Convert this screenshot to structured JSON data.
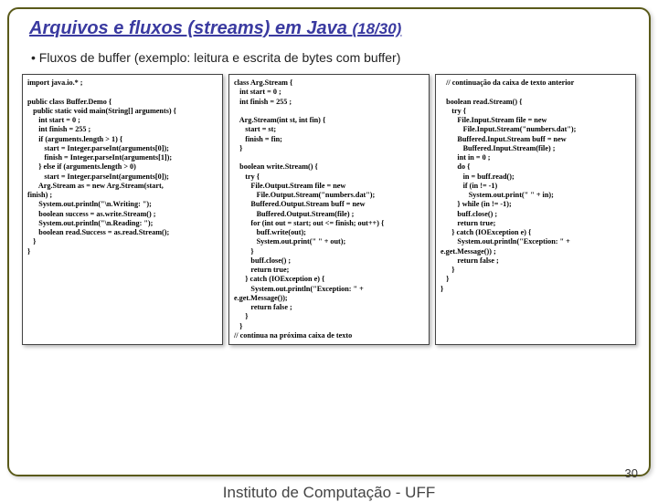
{
  "title_main": "Arquivos e fluxos (streams) em Java ",
  "title_count": "(18/30)",
  "bullet": "•   Fluxos de buffer (exemplo: leitura  e escrita de bytes com buffer)",
  "code": {
    "col1": "import java.io.* ;\n\npublic class Buffer.Demo {\n   public static void main(String[] arguments) {\n      int start = 0 ;\n      int finish = 255 ;\n      if (arguments.length > 1) {\n         start = Integer.parseInt(arguments[0]);\n         finish = Integer.parseInt(arguments[1]);\n      } else if (arguments.length > 0)\n         start = Integer.parseInt(arguments[0]);\n      Arg.Stream as = new Arg.Stream(start,\nfinish) ;\n      System.out.println(\"\\n.Writing: \");\n      boolean success = as.write.Stream() ;\n      System.out.println(\"\\n.Reading: \");\n      boolean read.Success = as.read.Stream();\n   }\n}",
    "col2": "class Arg.Stream {\n   int start = 0 ;\n   int finish = 255 ;\n\n   Arg.Stream(int st, int fin) {\n      start = st;\n      finish = fin;\n   }\n\n   boolean write.Stream() {\n      try {\n         File.Output.Stream file = new\n            File.Output.Stream(\"numbers.dat\");\n         Buffered.Output.Stream buff = new\n            Buffered.Output.Stream(file) ;\n         for (int out = start; out <= finish; out++) {\n            buff.write(out);\n            System.out.print(\" \" + out);\n         }\n         buff.close() ;\n         return true;\n      } catch (IOException e) {\n         System.out.println(\"Exception: \" +\ne.get.Message());\n         return false ;\n      }\n   }\n// continua na próxima caixa de texto",
    "col3": "   // continuação da caixa de texto anterior\n\n   boolean read.Stream() {\n      try {\n         File.Input.Stream file = new\n            File.Input.Stream(\"numbers.dat\");\n         Buffered.Input.Stream buff = new\n            Buffered.Input.Stream(file) ;\n         int in = 0 ;\n         do {\n            in = buff.read();\n            if (in != -1)\n               System.out.print(\" \" + in);\n         } while (in != -1);\n         buff.close() ;\n         return true;\n      } catch (IOException e) {\n         System.out.println(\"Exception: \" +\ne.get.Message()) ;\n         return false ;\n      }\n   }\n}"
  },
  "footer": "Instituto de Computação - UFF",
  "pagenum": "30"
}
